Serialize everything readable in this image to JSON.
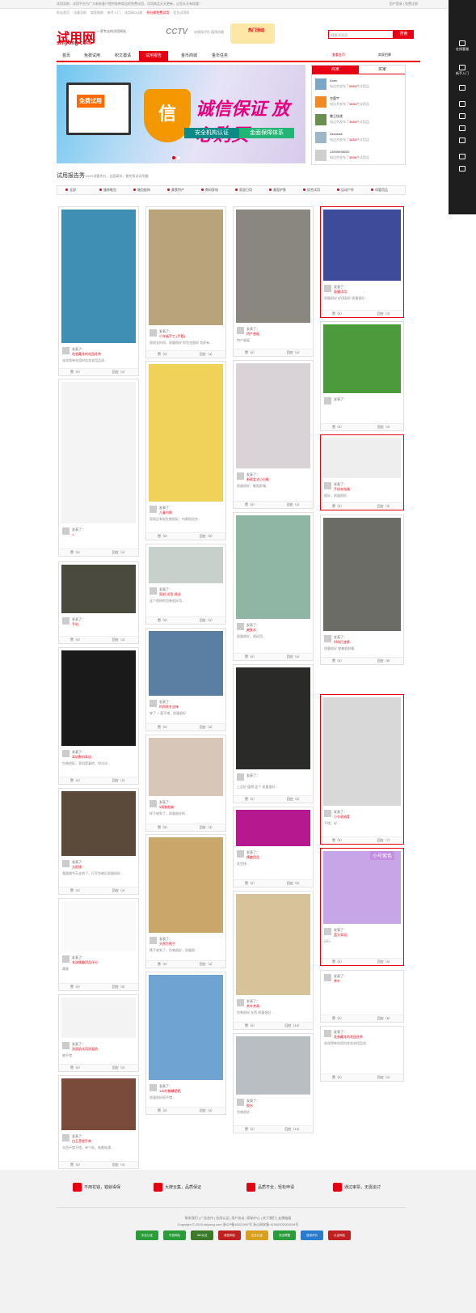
{
  "topbar": {
    "left": "试用导航：试用平台为广大新老客户提供各种商品的免费试用，试用商品天天更新，让您天天有惊喜！",
    "right": "用户登录 | 免费注册"
  },
  "subbar": [
    {
      "t": "抓去首页",
      "red": false
    },
    {
      "t": "试客导航",
      "red": false
    },
    {
      "t": "商家指南",
      "red": false
    },
    {
      "t": "新手入门",
      "red": false
    },
    {
      "t": "试用网QQ群",
      "red": false
    },
    {
      "t": "积分换免费试用",
      "red": true
    },
    {
      "t": "会员试用网",
      "red": false
    }
  ],
  "header": {
    "logo": "试用网",
    "domain": "shiyong.com",
    "tagline": "一家专业的试用网站",
    "cctv": "CCTV",
    "cctv_sub": "央视网评估 值得信赖",
    "award": "热门活动",
    "search_placeholder": "搜索试用品",
    "search_btn": "搜索"
  },
  "nav": [
    "首页",
    "免费试用",
    "积文邀请",
    "试用报告",
    "金币商城",
    "金币任务"
  ],
  "nav_active": 3,
  "nav_right": [
    "查看金币",
    "商家招募"
  ],
  "banner": {
    "pc_text": "免费试用",
    "shield": "信",
    "big": "诚信保证 放心购买",
    "pill1": "安全机构认证",
    "pill2": "金面保障体系"
  },
  "side": {
    "tabs": [
      "商家",
      "买家"
    ],
    "rows": [
      {
        "name": "Aoen",
        "desc": "电达共发布了",
        "n": "5865",
        "u": "件试用品"
      },
      {
        "name": "克鹿宇",
        "desc": "电达共发布了",
        "n": "3856",
        "u": "件试用品"
      },
      {
        "name": "撒旦快递",
        "desc": "电达共发布了",
        "n": "3856",
        "u": "件试用品"
      },
      {
        "name": "Desolate",
        "desc": "电达共发布了",
        "n": "3855",
        "u": "件试用品"
      },
      {
        "name": "13940936000",
        "desc": "电达共发布了",
        "n": "3896",
        "u": "件试用品"
      }
    ]
  },
  "section": {
    "title": "试用报告秀",
    "sub": "100%试客评价，全面真实，看完再试试用看!"
  },
  "cats": [
    "全部",
    "服饰鞋包",
    "箱包配饰",
    "美食特产",
    "数码家电",
    "家居日用",
    "美容护肤",
    "综合试用",
    "运动户外",
    "母婴用品"
  ],
  "cards": [
    {
      "who": "发表了：",
      "title": "花香藏花的花园花茶",
      "txt": "花花简单花用时花花本用品质...",
      "zan": "赞（0）",
      "pl": "回应（4）"
    },
    {
      "who": "发表了：",
      "title": "1",
      "txt": "",
      "zan": "赞（0）",
      "pl": "回应（4）"
    },
    {
      "who": "发表了：",
      "title": "手机",
      "txt": "包包质量不错，包包很多，看起来...",
      "zan": "赞（0）",
      "pl": "回应（4）"
    },
    {
      "who": "发表了：",
      "title": "耳机数码耳机",
      "txt": "包装很好，耳机是真的，你试试...",
      "zan": "赞（0）",
      "pl": "回应（2）"
    },
    {
      "who": "发表了：",
      "title": "太阳镜",
      "txt": "我刚刚今天去到了，打开包装后质量很好...",
      "zan": "赞（0）",
      "pl": "回应（4）"
    },
    {
      "who": "发表了：",
      "title": "名流情趣用品评分",
      "txt": "满意",
      "zan": "赞（0）",
      "pl": "回应（5）"
    },
    {
      "who": "发表了：",
      "title": "洗面奶试用洗面奶",
      "txt": "感不错",
      "zan": "赞（0）",
      "pl": "回应（0）"
    },
    {
      "who": "发表了：",
      "title": "白玉菩提手串",
      "txt": "东西不错不错，单个很，有都很漂...",
      "zan": "赞（0）",
      "pl": "回应（4）"
    },
    {
      "who": "发表了：",
      "title": "小年级手工 (手套)",
      "txt": "家很长时间，质量很好 你包也很好 包质有...",
      "zan": "赞（0）",
      "pl": "回应（4）"
    },
    {
      "who": "发表了：",
      "title": "儿童内裤",
      "txt": "家很还有现在都很好，内裤很适合...",
      "zan": "赞（0）",
      "pl": "回应（5）"
    },
    {
      "who": "发表了：",
      "title": "密封 试用 测试",
      "txt": "这个透明的包装很好用...",
      "zan": "赞（0）",
      "pl": "回应（4）"
    },
    {
      "who": "发表了：",
      "title": "时尚秋冬丝袜",
      "txt": "穿了 一直不错，质量很好...",
      "zan": "赞（0）",
      "pl": "回应（4）"
    },
    {
      "who": "发表了：",
      "title": "5双装船袜",
      "txt": "样子收到了，质量很好的...",
      "zan": "赞（0）",
      "pl": "回应（3）"
    },
    {
      "who": "发表了：",
      "title": "天然竹筷子",
      "txt": "筷子收到了，包装很好，质量很...",
      "zan": "赞（0）",
      "pl": "回应（4）"
    },
    {
      "who": "发表了：",
      "title": "100片蝴蝶墙贴",
      "txt": "质量很好很不错...",
      "zan": "赞（0）",
      "pl": "回应（4）"
    },
    {
      "who": "发表了：",
      "title": "特产香菇",
      "txt": "特产香菇",
      "zan": "赞（0）",
      "pl": "回应（4）"
    },
    {
      "who": "发表了：",
      "title": "新款女式小白鞋",
      "txt": "质量很好，鞋很舒服...",
      "zan": "赞（0）",
      "pl": "回应（4）"
    },
    {
      "who": "发表了：",
      "title": "爽肤水",
      "txt": "质量很好，很好用...",
      "zan": "赞（0）",
      "pl": "回应（4）"
    },
    {
      "who": "发表了：",
      "title": "",
      "txt": "上品好 值得 这个 质量很好...",
      "zan": "赞（0）",
      "pl": "回应（5）"
    },
    {
      "who": "发表了：",
      "title": "情趣用品",
      "txt": "发货快...",
      "zan": "赞（0）",
      "pl": "回应（5）"
    },
    {
      "who": "发表了：",
      "title": "茶叶茶具",
      "txt": "包装很好 东西 质量很好...",
      "zan": "赞（0）",
      "pl": "回应（10）"
    },
    {
      "who": "发表了：",
      "title": "胶水",
      "txt": "包装很好...",
      "zan": "赞（0）",
      "pl": "回应（10）"
    },
    {
      "who": "发表了：",
      "title": "面膜试用",
      "txt": "质量很好 好用很好 质量很好...",
      "zan": "赞（0）",
      "pl": "回应（3）"
    },
    {
      "who": "发表了：",
      "title": "",
      "txt": "",
      "zan": "赞（0）",
      "pl": "回应（4）"
    },
    {
      "who": "发表了：",
      "title": "手机充电器",
      "txt": "很好，质量很好...",
      "zan": "赞（0）",
      "pl": "回应（3）"
    },
    {
      "who": "发表了：",
      "title": "时尚打底裤",
      "txt": "质量很好 穿着很舒服...",
      "zan": "赞（0）",
      "pl": "回应（8）"
    },
    {
      "who": "发表了：",
      "title": "小号收纳筐",
      "txt": "不错，好...",
      "zan": "赞（0）",
      "pl": "回应（7）"
    },
    {
      "who": "发表了：",
      "title": "蓝牙耳机",
      "txt": "还行",
      "zan": "赞（0）",
      "pl": "回应（0）"
    },
    {
      "who": "发表了：",
      "title": "茶叶",
      "txt": "",
      "zan": "赞（0）",
      "pl": "回应（6）"
    }
  ],
  "basket_label": "小号紫色",
  "rail": [
    "在线客服",
    "新手入门",
    "",
    "",
    "",
    "",
    "",
    "",
    ""
  ],
  "footer": {
    "feats": [
      "不用花钱，错就得保",
      "大牌云集，品质保证",
      "品质齐全，轻松申请",
      "通过审票，无需追讨"
    ],
    "links": "联系我们 | 广告合作 | 信用认证 | 用户协议 | 帮助中心 | 关于我们 | 友情链接",
    "copy": "Copyright © 2016 shiyong.com 浙ICP备16021987号 浙公网安备 41050202000016号",
    "badges": [
      "实名认证",
      "可信网站",
      "360认证",
      "诚信网站",
      "企业认证",
      "安全联盟",
      "信用评价",
      "认证网站"
    ]
  }
}
